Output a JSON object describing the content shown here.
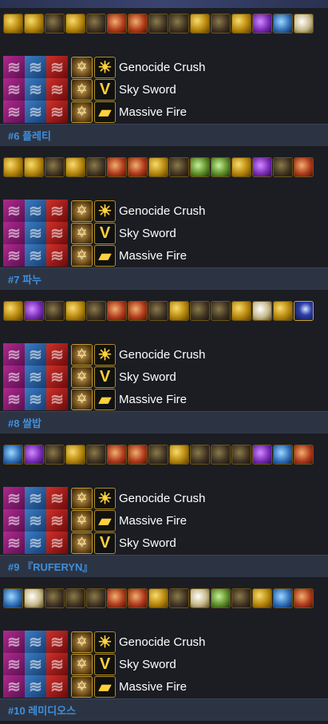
{
  "entries": [
    {
      "player": "#6 플레티",
      "icons": [
        "gold",
        "gold",
        "dark",
        "gold",
        "dark",
        "red",
        "red",
        "dark",
        "dark",
        "gold",
        "dark",
        "gold",
        "purple",
        "blue",
        "white"
      ],
      "skills": [
        "Genocide Crush",
        "Sky Sword",
        "Massive Fire"
      ],
      "skill_icons": [
        "sun-icon",
        "sword-icon",
        "fire-icon"
      ]
    },
    {
      "player": "#7 파누",
      "icons": [
        "gold",
        "gold",
        "dark",
        "gold",
        "dark",
        "red",
        "red",
        "gold",
        "dark",
        "green",
        "green",
        "gold",
        "purple",
        "dark",
        "red"
      ],
      "skills": [
        "Genocide Crush",
        "Sky Sword",
        "Massive Fire"
      ],
      "skill_icons": [
        "sun-icon",
        "sword-icon",
        "fire-icon"
      ]
    },
    {
      "player": "#8 쌀밥",
      "icons": [
        "gold",
        "purple",
        "dark",
        "gold",
        "dark",
        "red",
        "red",
        "dark",
        "gold",
        "dark",
        "dark",
        "gold",
        "white",
        "gold",
        "navy"
      ],
      "skills": [
        "Genocide Crush",
        "Sky Sword",
        "Massive Fire"
      ],
      "skill_icons": [
        "sun-icon",
        "sword-icon",
        "fire-icon"
      ]
    },
    {
      "player": "#9 『RUFERYN』",
      "icons": [
        "blue",
        "purple",
        "dark",
        "gold",
        "dark",
        "red",
        "red",
        "dark",
        "gold",
        "dark",
        "dark",
        "dark",
        "purple",
        "blue",
        "red"
      ],
      "skills": [
        "Genocide Crush",
        "Massive Fire",
        "Sky Sword"
      ],
      "skill_icons": [
        "sun-icon",
        "fire-icon",
        "sword-icon"
      ]
    },
    {
      "player": "#10 레미디오스",
      "icons": [
        "blue",
        "white",
        "dark",
        "dark",
        "dark",
        "red",
        "red",
        "gold",
        "dark",
        "white",
        "green",
        "dark",
        "gold",
        "blue",
        "red"
      ],
      "skills": [
        "Genocide Crush",
        "Sky Sword",
        "Massive Fire"
      ],
      "skill_icons": [
        "sun-icon",
        "sword-icon",
        "fire-icon"
      ]
    }
  ],
  "glyphs": {
    "sun-icon": "☀",
    "sword-icon": "V",
    "fire-icon": "▰",
    "node-icon": "✡",
    "swirl-icon": "≋"
  }
}
